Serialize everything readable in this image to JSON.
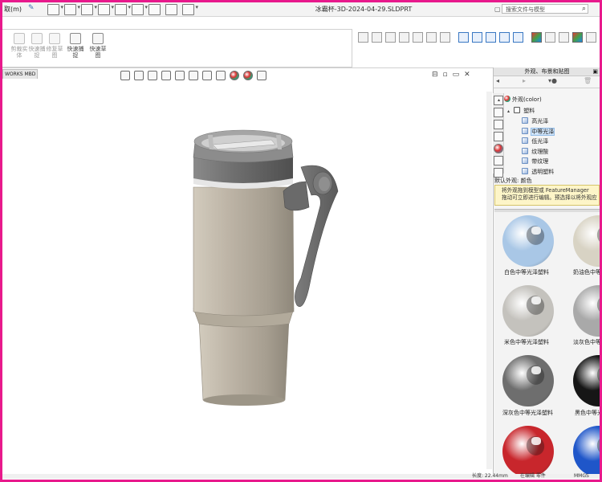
{
  "titlebar": {
    "menu_label": "取(m)",
    "document_title": "冰霸杯-3D-2024-04-29.SLDPRT",
    "search_placeholder": "搜索文件与模型"
  },
  "command_manager": {
    "buttons": [
      {
        "label": "剪裁实体",
        "enabled": false
      },
      {
        "label": "快速捕捉",
        "enabled": false
      },
      {
        "label": "修复草图",
        "enabled": false
      },
      {
        "label": "快速捕捉",
        "enabled": true
      },
      {
        "label": "快速草图",
        "enabled": true
      }
    ]
  },
  "left_tab": {
    "label": "WORKS MBD"
  },
  "task_pane": {
    "title": "外观、布景和贴图",
    "tree": [
      {
        "label": "外观(color)",
        "level": 0,
        "expanded": true,
        "icon": "appearance-icon"
      },
      {
        "label": "塑料",
        "level": 1,
        "expanded": true,
        "icon": "folder-icon"
      },
      {
        "label": "高光泽",
        "level": 2,
        "icon": "material-icon"
      },
      {
        "label": "中等光泽",
        "level": 2,
        "icon": "material-icon",
        "selected": true
      },
      {
        "label": "低光泽",
        "level": 2,
        "icon": "material-icon"
      },
      {
        "label": "纹理酸",
        "level": 2,
        "icon": "material-icon"
      },
      {
        "label": "带纹理",
        "level": 2,
        "icon": "material-icon"
      },
      {
        "label": "透明塑料",
        "level": 2,
        "icon": "material-icon"
      }
    ],
    "default_label": "默认外观: 颜色",
    "tip_lines": [
      "将外观拖到模型或 FeatureManager",
      "拖动可立即进行编辑。预选择以将外观应"
    ],
    "swatches": [
      {
        "label": "白色中等光泽塑料",
        "color": "#a9c7e6"
      },
      {
        "label": "奶油色中等",
        "color": "#d8d3c4"
      },
      {
        "label": "米色中等光泽塑料",
        "color": "#c4c2bd"
      },
      {
        "label": "淡灰色中等",
        "color": "#a9a9a9"
      },
      {
        "label": "深灰色中等光泽塑料",
        "color": "#6e6e6e"
      },
      {
        "label": "黑色中等光",
        "color": "#161616"
      },
      {
        "label": "",
        "color": "#c8262c"
      },
      {
        "label": "",
        "color": "#1f56c9"
      }
    ]
  },
  "statusbar": {
    "length": "长度: 22.44mm",
    "state": "在编辑 零件",
    "units": "MMGS"
  },
  "colors": {
    "frame": "#e8198c",
    "cup_body": "#b4ab9c",
    "lid_dark": "#6f6f6f",
    "handle": "#6d6d6d"
  }
}
